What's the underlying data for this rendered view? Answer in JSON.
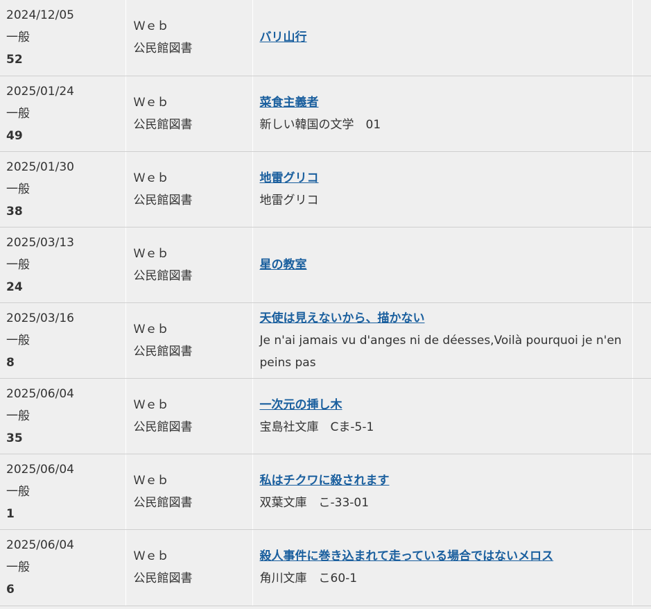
{
  "rows": [
    {
      "date": "2024/12/05",
      "category": "一般",
      "count": "52",
      "type": "Ｗｅｂ",
      "library": "公民館図書",
      "title": "バリ山行",
      "series": ""
    },
    {
      "date": "2025/01/24",
      "category": "一般",
      "count": "49",
      "type": "Ｗｅｂ",
      "library": "公民館図書",
      "title": "菜食主義者",
      "series": "新しい韓国の文学　01"
    },
    {
      "date": "2025/01/30",
      "category": "一般",
      "count": "38",
      "type": "Ｗｅｂ",
      "library": "公民館図書",
      "title": "地雷グリコ",
      "series": "地雷グリコ"
    },
    {
      "date": "2025/03/13",
      "category": "一般",
      "count": "24",
      "type": "Ｗｅｂ",
      "library": "公民館図書",
      "title": "星の教室",
      "series": ""
    },
    {
      "date": "2025/03/16",
      "category": "一般",
      "count": "8",
      "type": "Ｗｅｂ",
      "library": "公民館図書",
      "title": "天使は見えないから、描かない",
      "series": "Je n'ai jamais vu d'anges ni de déesses,Voilà pourquoi je n'en peins pas"
    },
    {
      "date": "2025/06/04",
      "category": "一般",
      "count": "35",
      "type": "Ｗｅｂ",
      "library": "公民館図書",
      "title": "一次元の挿し木",
      "series": "宝島社文庫　Cま-5-1"
    },
    {
      "date": "2025/06/04",
      "category": "一般",
      "count": "1",
      "type": "Ｗｅｂ",
      "library": "公民館図書",
      "title": "私はチクワに殺されます",
      "series": "双葉文庫　こ-33-01"
    },
    {
      "date": "2025/06/04",
      "category": "一般",
      "count": "6",
      "type": "Ｗｅｂ",
      "library": "公民館図書",
      "title": "殺人事件に巻き込まれて走っている場合ではないメロス",
      "series": "角川文庫　こ60-1"
    }
  ]
}
